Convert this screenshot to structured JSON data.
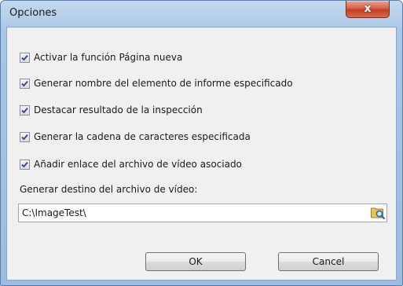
{
  "window": {
    "title": "Opciones",
    "close_glyph": "x"
  },
  "options": [
    {
      "label": "Activar la función Página nueva",
      "checked": true
    },
    {
      "label": "Generar nombre del elemento de informe especificado",
      "checked": true
    },
    {
      "label": "Destacar resultado de la inspección",
      "checked": true
    },
    {
      "label": "Generar la cadena de caracteres especificada",
      "checked": true
    },
    {
      "label": "Añadir enlace del archivo de vídeo asociado",
      "checked": true
    }
  ],
  "video_destination": {
    "label": "Generar destino del archivo de vídeo:",
    "value": "C:\\ImageTest\\",
    "browse_icon": "folder-search-icon"
  },
  "buttons": {
    "ok_label": "OK",
    "cancel_label": "Cancel"
  },
  "colors": {
    "close_button": "#c23b21",
    "frame": "#a9c6e6",
    "client_bg": "#f0f0f0"
  }
}
